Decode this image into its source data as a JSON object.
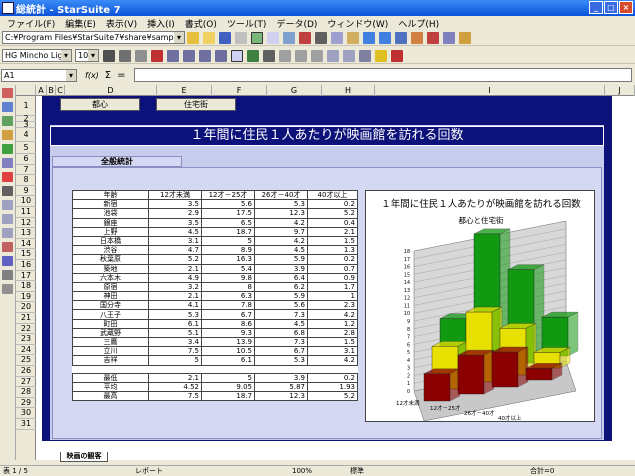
{
  "window": {
    "title": "総統計 - StarSuite 7",
    "minimize": "_",
    "maximize": "□",
    "close": "×"
  },
  "menu": [
    "ファイル(F)",
    "編集(E)",
    "表示(V)",
    "挿入(I)",
    "書式(O)",
    "ツール(T)",
    "データ(D)",
    "ウィンドウ(W)",
    "ヘルプ(H)"
  ],
  "toolbar": {
    "path": "C:¥Program Files¥StarSuite7¥share¥samples¥japanes",
    "font": "HG Mincho Light",
    "size": "10"
  },
  "formula": {
    "cellref": "A1",
    "fx": "f(x)",
    "sum": "Σ",
    "eq": "="
  },
  "columns": [
    "A",
    "B",
    "C",
    "D",
    "E",
    "F",
    "G",
    "H",
    "I",
    "J"
  ],
  "rows": [
    "1",
    "2",
    "3",
    "4",
    "5",
    "6",
    "7",
    "8",
    "9",
    "10",
    "11",
    "12",
    "13",
    "14",
    "15",
    "16",
    "17",
    "18",
    "19",
    "20",
    "21",
    "22",
    "23",
    "24",
    "25",
    "26",
    "27",
    "28",
    "29",
    "30",
    "31"
  ],
  "buttons": {
    "toshin": "都心",
    "jutakugai": "住宅街"
  },
  "banner": "１年間に住民１人あたりが映画館を訪れる回数",
  "tab_label": "全般統計",
  "table": {
    "headers": [
      "年齢",
      "12才未満",
      "12才－25才",
      "26才－40才",
      "40才以上"
    ],
    "rows": [
      [
        "新宿",
        "3.5",
        "5.6",
        "5.3",
        "0.2"
      ],
      [
        "池袋",
        "2.9",
        "17.5",
        "12.3",
        "5.2"
      ],
      [
        "銀座",
        "3.5",
        "6.5",
        "4.2",
        "0.4"
      ],
      [
        "上野",
        "4.5",
        "18.7",
        "9.7",
        "2.1"
      ],
      [
        "日本橋",
        "3.1",
        "5",
        "4.2",
        "1.5"
      ],
      [
        "渋谷",
        "4.7",
        "8.9",
        "4.5",
        "1.3"
      ],
      [
        "秋葉原",
        "5.2",
        "16.3",
        "5.9",
        "0.2"
      ],
      [
        "築地",
        "2.1",
        "5.4",
        "3.9",
        "0.7"
      ],
      [
        "六本木",
        "4.9",
        "9.8",
        "6.4",
        "0.9"
      ],
      [
        "原宿",
        "3.2",
        "8",
        "6.2",
        "1.7"
      ],
      [
        "神田",
        "2.1",
        "6.3",
        "5.9",
        "1"
      ],
      [
        "国分寺",
        "4.1",
        "7.8",
        "5.6",
        "2.3"
      ],
      [
        "八王子",
        "5.3",
        "6.7",
        "7.3",
        "4.2"
      ],
      [
        "町田",
        "6.1",
        "8.6",
        "4.5",
        "1.2"
      ],
      [
        "武蔵野",
        "5.1",
        "9.3",
        "6.8",
        "2.8"
      ],
      [
        "三鷹",
        "3.4",
        "13.9",
        "7.3",
        "1.5"
      ],
      [
        "立川",
        "7.5",
        "10.5",
        "6.7",
        "3.1"
      ],
      [
        "吉祥",
        "5",
        "6.1",
        "5.3",
        "4.2"
      ]
    ],
    "summary": [
      [
        "最低",
        "2.1",
        "5",
        "3.9",
        "0.2"
      ],
      [
        "平均",
        "4.52",
        "9.05",
        "5.87",
        "1.93"
      ],
      [
        "最高",
        "7.5",
        "18.7",
        "12.3",
        "5.2"
      ]
    ]
  },
  "chart_data": {
    "type": "bar",
    "title": "１年間に住民１人あたりが映画館を訪れる回数",
    "subtitle": "都心と住宅街",
    "categories": [
      "12才未満",
      "12才－25才",
      "26才－40才",
      "40才以上"
    ],
    "series": [
      {
        "values": [
          3.5,
          5.0,
          4.5,
          1.5
        ],
        "color": "#8b0000"
      },
      {
        "values": [
          5.5,
          9.0,
          6.0,
          2.0
        ],
        "color": "#e8e000"
      },
      {
        "values": [
          7.5,
          17.5,
          12.0,
          5.0
        ],
        "color": "#119911"
      }
    ],
    "yticks": [
      "0",
      "1",
      "2",
      "3",
      "4",
      "5",
      "6",
      "7",
      "8",
      "9",
      "10",
      "11",
      "12",
      "13",
      "14",
      "15",
      "16",
      "17",
      "18"
    ],
    "ylim": [
      0,
      18
    ]
  },
  "sheet_tab": "映画の観客",
  "status": {
    "page": "表 1 / 5",
    "style": "レポート",
    "zoom": "100%",
    "mode": "標準",
    "sum": "合計=0"
  },
  "colors": {
    "navy": "#0d127a",
    "panel": "#c8ccec"
  }
}
